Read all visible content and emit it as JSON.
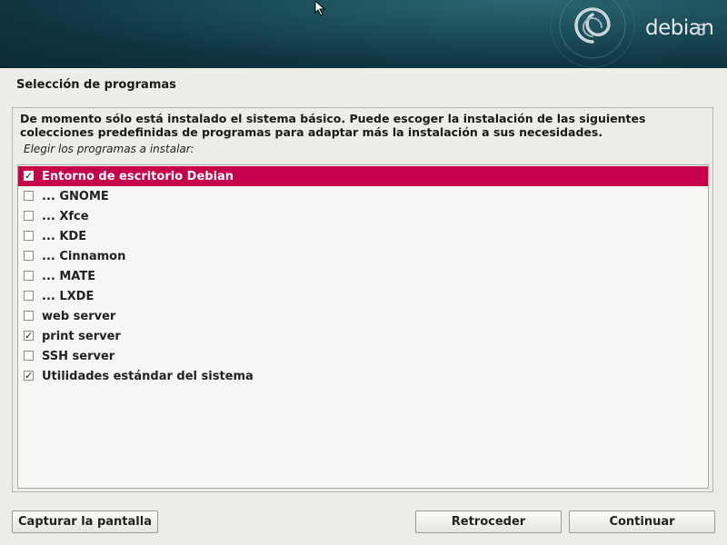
{
  "banner": {
    "logo_text": "debian",
    "logo_version": "8",
    "swirl_icon": "debian-swirl-icon",
    "pointer_icon": "mouse-pointer-icon"
  },
  "page": {
    "title": "Selección de programas",
    "description_line1": "De momento sólo está instalado el sistema básico. Puede escoger la instalación de las siguientes",
    "description_line2": "colecciones predefinidas de programas para adaptar más la instalación a sus necesidades.",
    "prompt": "Elegir los programas a instalar:"
  },
  "options": [
    {
      "label": "Entorno de escritorio Debian",
      "checked": true,
      "selected": true
    },
    {
      "label": "... GNOME",
      "checked": false,
      "selected": false
    },
    {
      "label": "... Xfce",
      "checked": false,
      "selected": false
    },
    {
      "label": "... KDE",
      "checked": false,
      "selected": false
    },
    {
      "label": "... Cinnamon",
      "checked": false,
      "selected": false
    },
    {
      "label": "... MATE",
      "checked": false,
      "selected": false
    },
    {
      "label": "... LXDE",
      "checked": false,
      "selected": false
    },
    {
      "label": "web server",
      "checked": false,
      "selected": false
    },
    {
      "label": "print server",
      "checked": true,
      "selected": false
    },
    {
      "label": "SSH server",
      "checked": false,
      "selected": false
    },
    {
      "label": "Utilidades estándar del sistema",
      "checked": true,
      "selected": false
    }
  ],
  "buttons": {
    "screenshot": "Capturar la pantalla",
    "back": "Retroceder",
    "continue": "Continuar"
  },
  "colors": {
    "selection": "#c7004b",
    "banner": "#0f3440",
    "background": "#edece6"
  }
}
